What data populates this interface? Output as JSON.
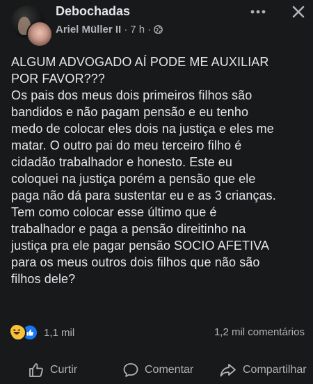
{
  "header": {
    "group_name": "Debochadas",
    "author": "Ariel Müller II",
    "time": "7 h",
    "separator": "·"
  },
  "post": {
    "text": "ALGUM ADVOGADO AÍ PODE ME AUXILIAR\nPOR FAVOR???\nOs pais dos meus dois primeiros filhos são\nbandidos e não pagam pensão e eu tenho\nmedo de colocar eles dois na justiça e eles me\nmatar. O outro pai do meu terceiro filho é\ncidadão trabalhador e honesto. Este eu\ncoloquei na justiça porém a pensão que ele\npaga não dá para sustentar eu e as 3 crianças.\nTem como colocar esse último que é\ntrabalhador e paga a pensão direitinho na\njustiça pra ele pagar pensão SOCIO AFETIVA\npara os meus outros dois filhos que não são\nfilhos dele?"
  },
  "stats": {
    "reactions_count": "1,1 mil",
    "comments_count": "1,2 mil comentários"
  },
  "actions": {
    "like": "Curtir",
    "comment": "Comentar",
    "share": "Compartilhar"
  },
  "icons": {
    "more": "more-horizontal-icon",
    "close": "close-icon",
    "privacy": "globe-icon",
    "reaction_haha": "haha-reaction-icon",
    "reaction_like": "like-reaction-icon"
  },
  "colors": {
    "background": "#18191a",
    "text_primary": "#e4e6eb",
    "text_secondary": "#b0b3b8",
    "like_blue": "#1877f2",
    "haha_yellow": "#f7c33b"
  }
}
